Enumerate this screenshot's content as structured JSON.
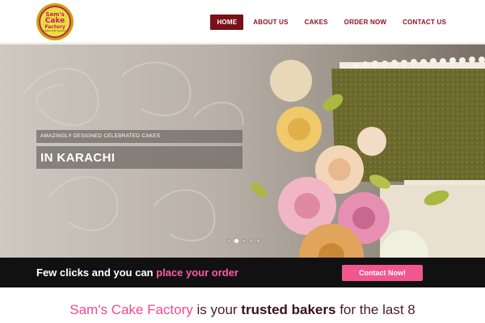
{
  "header": {
    "logo": {
      "line1": "Sam's",
      "line2": "Cake",
      "line3": "Factory",
      "tagline": "Cakes with passion"
    },
    "nav": [
      {
        "label": "HOME",
        "active": true
      },
      {
        "label": "ABOUT US",
        "active": false
      },
      {
        "label": "CAKES",
        "active": false
      },
      {
        "label": "ORDER NOW",
        "active": false
      },
      {
        "label": "CONTACT US",
        "active": false
      }
    ]
  },
  "hero": {
    "subtitle": "AMAZINGLY DESIGNED CELEBRATED CAKES",
    "title": "IN KARACHI",
    "slide_count": 5,
    "active_slide": 2
  },
  "cta": {
    "text_plain": "Few clicks and you can ",
    "text_highlight": "place your order",
    "button_label": "Contact Now!"
  },
  "intro": {
    "brand": "Sam's Cake Factory",
    "text1": " is your ",
    "bold": "trusted bakers",
    "text2": " for the last 8"
  },
  "colors": {
    "nav_active": "#7a1018",
    "nav_text": "#8a1220",
    "cta_bar": "#111111",
    "cta_highlight": "#ff5aa8",
    "cta_button": "#f2568f",
    "brand_pink": "#f04a8e"
  }
}
